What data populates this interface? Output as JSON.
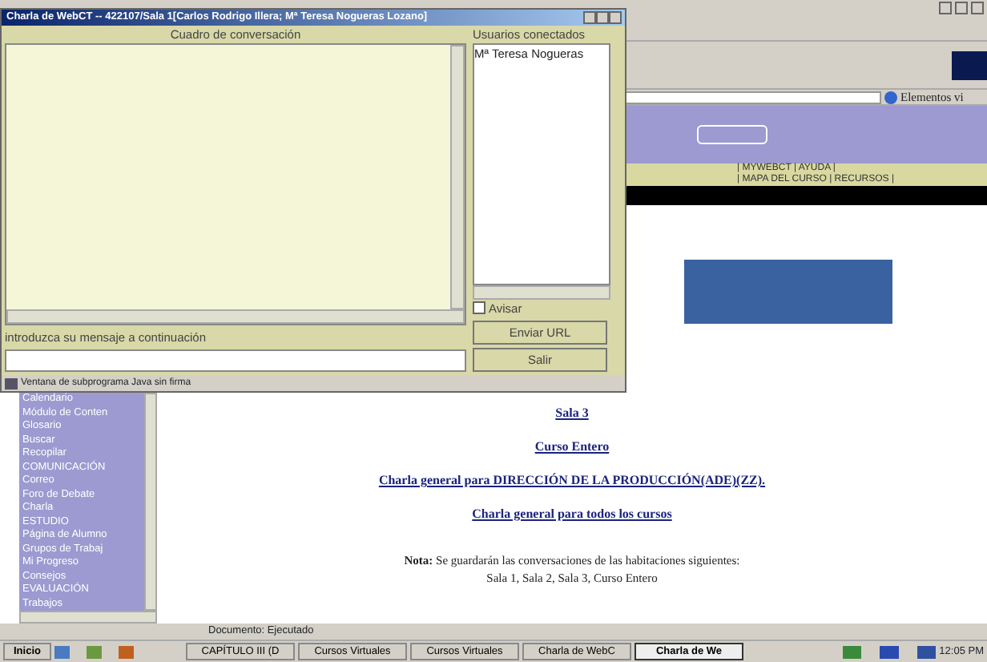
{
  "browser": {
    "address_extra": "Elementos vi",
    "nav_links": [
      {
        "text": "| MYWEBCT | AYUDA |"
      },
      {
        "text": "| MAPA DEL CURSO | RECURSOS |"
      }
    ],
    "sidebar": {
      "items": [
        "Calendario",
        "Módulo de Conten",
        "Glosario",
        "Buscar",
        "Recopilar",
        "COMUNICACIÓN",
        "Correo",
        "Foro de Debate",
        "Charla",
        "ESTUDIO",
        "Página de Alumno",
        "Grupos de Trabaj",
        "Mi Progreso",
        "Consejos",
        "EVALUACIÓN",
        "Trabajos"
      ]
    },
    "links": [
      "Sala 3",
      "Curso Entero",
      "Charla general para DIRECCIÓN DE LA PRODUCCIÓN(ADE)(ZZ).",
      "Charla general para todos los cursos"
    ],
    "note": {
      "label": "Nota:",
      "text": "Se guardarán las conversaciones de las habitaciones siguientes:",
      "rooms": "Sala 1, Sala 2, Sala 3, Curso Entero"
    },
    "status_bar": "Documento: Ejecutado"
  },
  "chat_window": {
    "title": "Charla de WebCT -- 422107/Sala 1[Carlos Rodrigo Illera; Mª Teresa Nogueras Lozano]",
    "conversation_label": "Cuadro de conversación",
    "users_label": "Usuarios conectados",
    "users": [
      "Mª Teresa Nogueras"
    ],
    "notify": {
      "label": "Avisar",
      "checked": false
    },
    "message_label": "introduzca su mensaje a continuación",
    "buttons": [
      "Enviar URL",
      "Salir"
    ],
    "applet_status": "Ventana de subprograma Java sin firma"
  },
  "taskbar": {
    "start": "Inicio",
    "tasks": [
      {
        "label": "CAPÍTULO III (D",
        "selected": false
      },
      {
        "label": "Cursos Virtuales",
        "selected": false
      },
      {
        "label": "Cursos Virtuales",
        "selected": false
      },
      {
        "label": "Charla de WebC",
        "selected": false
      },
      {
        "label": "Charla de We",
        "selected": true
      }
    ],
    "clock": "12:05 PM"
  }
}
